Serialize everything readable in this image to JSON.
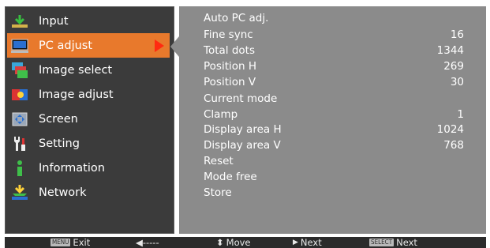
{
  "sidebar": {
    "items": [
      {
        "label": "Input",
        "icon": "input-icon"
      },
      {
        "label": "PC adjust",
        "icon": "pc-adjust-icon",
        "active": true
      },
      {
        "label": "Image select",
        "icon": "image-select-icon"
      },
      {
        "label": "Image adjust",
        "icon": "image-adjust-icon"
      },
      {
        "label": "Screen",
        "icon": "screen-icon"
      },
      {
        "label": "Setting",
        "icon": "setting-icon"
      },
      {
        "label": "Information",
        "icon": "information-icon"
      },
      {
        "label": "Network",
        "icon": "network-icon"
      }
    ]
  },
  "main": {
    "rows": [
      {
        "label": "Auto PC adj.",
        "value": ""
      },
      {
        "label": "Fine sync",
        "value": "16"
      },
      {
        "label": "Total dots",
        "value": "1344"
      },
      {
        "label": "Position H",
        "value": "269"
      },
      {
        "label": "Position V",
        "value": "30"
      },
      {
        "label": "Current mode",
        "value": ""
      },
      {
        "label": "Clamp",
        "value": "1"
      },
      {
        "label": "Display area H",
        "value": "1024"
      },
      {
        "label": "Display area V",
        "value": "768"
      },
      {
        "label": "Reset",
        "value": ""
      },
      {
        "label": "Mode free",
        "value": ""
      },
      {
        "label": "Store",
        "value": ""
      }
    ]
  },
  "footer": {
    "exit_key": "MENU",
    "exit_label": "Exit",
    "back_label": "◀-----",
    "move_label": "Move",
    "next_label": "Next",
    "select_key": "SELECT",
    "select_next_label": "Next"
  },
  "colors": {
    "sidebar_bg": "#3b3b3b",
    "main_bg": "#8b8b8b",
    "active_bg": "#e8792c",
    "active_arrow": "#ff2a10",
    "footer_bg": "#2b2b2b"
  }
}
